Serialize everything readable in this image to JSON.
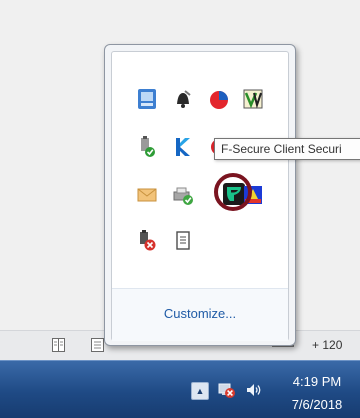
{
  "tooltip": {
    "text": "F-Secure Client Securi"
  },
  "flyout": {
    "customize_label": "Customize...",
    "icons": [
      "network-status-icon",
      "notification-bell-icon",
      "pie-chart-icon",
      "vm-app-icon",
      "usb-device-icon",
      "blue-k-app-icon",
      "red-app-icon",
      "blue-app-icon",
      "mail-icon",
      "printer-check-icon",
      "f-secure-icon",
      "display-app-icon",
      "usb-error-icon",
      "clipboard-icon"
    ],
    "highlighted_icon": "f-secure-icon"
  },
  "statusbar": {
    "zoom_text": "+ 120"
  },
  "taskbar": {
    "show_hidden_glyph": "▲",
    "clock_time": "4:19 PM",
    "clock_date": "7/6/2018"
  },
  "colors": {
    "taskbar": "#1f4a85",
    "highlight_ring": "#7a1420",
    "link": "#1f5ba6",
    "f_secure_green": "#19c38a"
  }
}
